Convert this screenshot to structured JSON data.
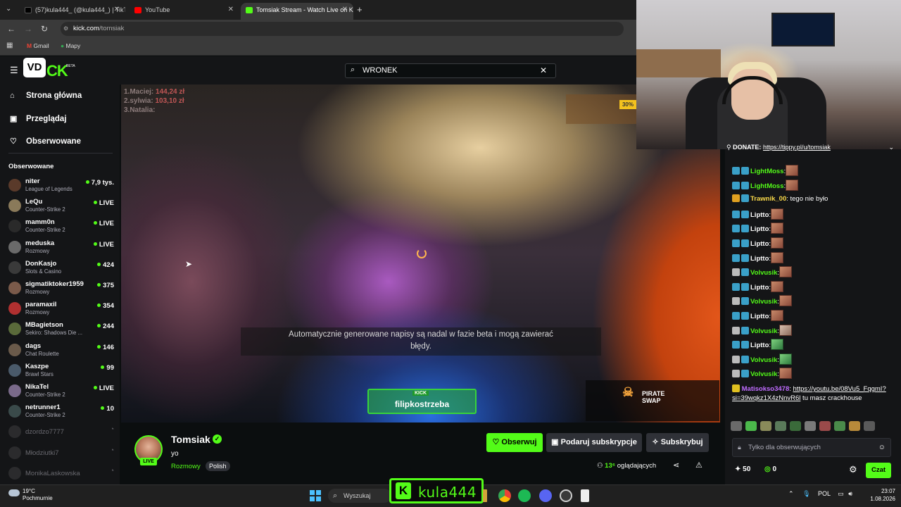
{
  "browser": {
    "tabs": [
      {
        "label": "(57)kula444_ (@kula444_) | TikTok",
        "active": false,
        "color": "#000000"
      },
      {
        "label": "YouTube",
        "active": false,
        "color": "#ff0000"
      },
      {
        "label": "Tomsiak Stream - Watch Live on Kick",
        "active": true,
        "color": "#53fc18"
      }
    ],
    "url_host": "kick.com",
    "url_path": "/tomsiak",
    "bookmarks": [
      "Gmail",
      "Mapy"
    ]
  },
  "kick": {
    "logo_text": "CK",
    "logo_badge": "BETA",
    "search_value": "WRONEK",
    "nav": [
      {
        "label": "Strona główna",
        "icon": "home-icon"
      },
      {
        "label": "Przeglądaj",
        "icon": "browse-icon"
      },
      {
        "label": "Obserwowane",
        "icon": "heart-icon"
      }
    ],
    "followed_title": "Obserwowane",
    "channels": [
      {
        "name": "niter",
        "game": "League of Legends",
        "viewers": "7,9 tys.",
        "live": true
      },
      {
        "name": "LeQu",
        "game": "Counter-Strike 2",
        "viewers": "LIVE",
        "live": true
      },
      {
        "name": "mamm0n",
        "game": "Counter-Strike 2",
        "viewers": "LIVE",
        "live": true
      },
      {
        "name": "meduska",
        "game": "Rozmowy",
        "viewers": "LIVE",
        "live": true
      },
      {
        "name": "DonKasjo",
        "game": "Slots & Casino",
        "viewers": "424",
        "live": true
      },
      {
        "name": "sigmatiktoker1959",
        "game": "Rozmowy",
        "viewers": "375",
        "live": true
      },
      {
        "name": "paramaxil",
        "game": "Rozmowy",
        "viewers": "354",
        "live": true
      },
      {
        "name": "MBagietson",
        "game": "Sekiro: Shadows Die ...",
        "viewers": "244",
        "live": true
      },
      {
        "name": "dags",
        "game": "Chat Roulette",
        "viewers": "146",
        "live": true
      },
      {
        "name": "Kaszpe",
        "game": "Brawl Stars",
        "viewers": "99",
        "live": true
      },
      {
        "name": "NikaTel",
        "game": "Counter-Strike 2",
        "viewers": "LIVE",
        "live": true
      },
      {
        "name": "netrunner1",
        "game": "Counter-Strike 2",
        "viewers": "10",
        "live": true
      },
      {
        "name": "dzordzo7777",
        "game": "",
        "viewers": "",
        "live": false
      },
      {
        "name": "Młodziutki7",
        "game": "",
        "viewers": "",
        "live": false
      },
      {
        "name": "MonikaLaskowska",
        "game": "",
        "viewers": "",
        "live": false
      }
    ]
  },
  "video": {
    "ranking": [
      "1.Maciej:",
      "2.sylwia:",
      "3.Natalia:"
    ],
    "ranking_amounts": [
      "144,24 zł",
      "103,10 zł",
      ""
    ],
    "promo_badge": "30%",
    "caption_line1": "Automatycznie generowane napisy są nadal w fazie beta i mogą zawierać",
    "caption_line2": "błędy.",
    "overlay_kick": "KICK",
    "overlay_name": "filipkostrzeba",
    "pirate_line1": "PIRATE",
    "pirate_line2": "SWAP"
  },
  "stream": {
    "streamer": "Tomsiak",
    "live_badge": "LIVE",
    "title": "yo",
    "category": "Rozmowy",
    "language": "Polish",
    "follow_label": "Obserwuj",
    "gift_label": "Podaruj subskrypcje",
    "subscribe_label": "Subskrybuj",
    "viewers": "13⁶",
    "viewers_suffix": "oglądających"
  },
  "chat": {
    "donate_text": "DONATE:",
    "donate_link": "https://tippy.pl/u/tomsiak",
    "messages": [
      {
        "user": "LightMoss",
        "color": "#53fc18",
        "text": ""
      },
      {
        "user": "LightMoss",
        "color": "#53fc18",
        "text": ""
      },
      {
        "user": "Trawnik_00",
        "color": "#f9d949",
        "text": " tego nie było"
      },
      {
        "user": "Liptto",
        "color": "#ffffff",
        "text": ""
      },
      {
        "user": "Liptto",
        "color": "#ffffff",
        "text": ""
      },
      {
        "user": "Liptto",
        "color": "#ffffff",
        "text": ""
      },
      {
        "user": "Liptto",
        "color": "#ffffff",
        "text": ""
      },
      {
        "user": "Volvusik",
        "color": "#53fc18",
        "text": ""
      },
      {
        "user": "Liptto",
        "color": "#ffffff",
        "text": ""
      },
      {
        "user": "Volvusik",
        "color": "#53fc18",
        "text": ""
      },
      {
        "user": "Liptto",
        "color": "#ffffff",
        "text": ""
      },
      {
        "user": "Volvusik",
        "color": "#53fc18",
        "text": ""
      },
      {
        "user": "Liptto",
        "color": "#ffffff",
        "text": ""
      },
      {
        "user": "Volvusik",
        "color": "#53fc18",
        "text": ""
      },
      {
        "user": "Volvusik",
        "color": "#53fc18",
        "text": ""
      }
    ],
    "link_user": "Matisokso3478",
    "link_url": "https://youtu.be/08Vu5_FqgmI?si=39wqkz1X4zNnvR6l",
    "link_suffix": " tu masz crackhouse",
    "input_placeholder": "Tylko dla obserwujących",
    "points": "50",
    "gifts": "0",
    "chat_button": "Czat"
  },
  "taskbar": {
    "weather_temp": "19°C",
    "weather_desc": "Pochmurnie",
    "search_label": "Wyszukaj",
    "overlay_tag": "kula444",
    "lang": "POL",
    "time": "23:07",
    "date": "1.08.2026"
  }
}
